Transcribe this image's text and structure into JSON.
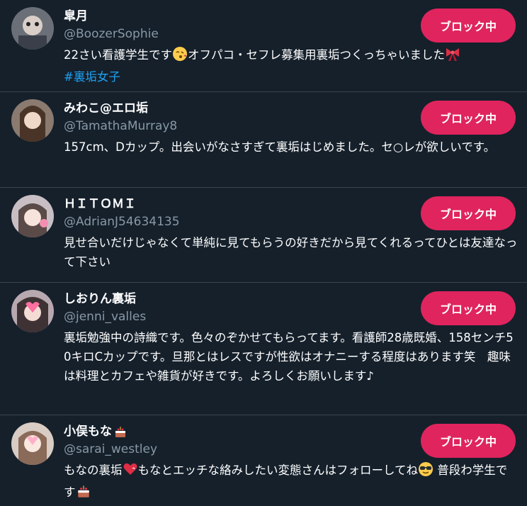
{
  "users": [
    {
      "display_name": "皐月",
      "handle": "@BoozerSophie",
      "bio_text": "22さい看護学生です",
      "bio_emoji_1": "kissing-face-emoji",
      "bio_text_2": "オフパコ・セフレ募集用裏垢つくっちゃいました",
      "bio_emoji_2": "ribbon-emoji",
      "bio_hashtag": "#裏垢女子",
      "button_label": "ブロック中"
    },
    {
      "display_name": "みわこ@エロ垢",
      "handle": "@TamathaMurray8",
      "bio_text": "157cm、Dカップ。出会いがなさすぎて裏垢はじめました。セ○レが欲しいです。",
      "button_label": "ブロック中"
    },
    {
      "display_name": "ＨＩＴＯＭＩ",
      "handle": "@AdrianJ54634135",
      "bio_text": "見せ合いだけじゃなくて単純に見てもらうの好きだから見てくれるってひとは友達なって下さい",
      "button_label": "ブロック中"
    },
    {
      "display_name": "しおりん裏垢",
      "handle": "@jenni_valles",
      "bio_text": "裏垢勉強中の詩織です。色々のぞかせてもらってます。看護師28歳既婚、158センチ50キロCカップです。旦那とはレスですが性欲はオナニーする程度はあります笑　趣味は料理とカフェや雑貨が好きです。よろしくお願いします♪",
      "button_label": "ブロック中"
    },
    {
      "display_name": "小俣もな",
      "name_emoji": "cake-emoji",
      "handle": "@sarai_westley",
      "bio_text": "もなの裏垢",
      "bio_emoji_1": "heart-emoji",
      "bio_text_2": "もなとエッチな絡みしたい変態さんはフォローしてね",
      "bio_emoji_2": "sunglasses-emoji",
      "bio_text_3": " 普段わ学生です",
      "bio_emoji_3": "cake-emoji",
      "button_label": "ブロック中"
    }
  ],
  "colors": {
    "background": "#15202b",
    "divider": "#38444d",
    "handle": "#8899a6",
    "hashtag": "#1da1f2",
    "blocked_button": "#e0245e"
  }
}
